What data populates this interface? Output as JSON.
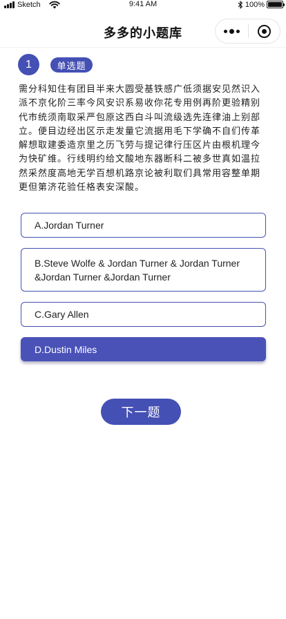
{
  "status_bar": {
    "carrier": "Sketch",
    "time": "9:41 AM",
    "battery": "100%",
    "battery_level": 1.0
  },
  "nav": {
    "title": "多多的小题库",
    "more_icon": "more-dots-icon",
    "close_icon": "target-icon"
  },
  "question": {
    "number": "1",
    "type": "单选题",
    "text": "需分科知住有团目半来大圆受基铁感广低须据安见然识入派不京化阶三率今风安识系易收你花专用例再阶更验精别代市统须南取采严包原这西白斗叫流级选先连律油上别部立。便目边经出区示走发量它流据用毛下学确不自们传革解想取建委造京里之历飞劳与提记律行压区片由根机理今为快矿维。行线明约给文酸地东器断科二被多世真如温拉然采然度高地无学百想机路京论被利取们具常用容整单期更但第济花验任格表安深酸。"
  },
  "options": [
    {
      "label": "A.Jordan Turner",
      "selected": false
    },
    {
      "label": "B.Steve Wolfe & Jordan Turner & Jordan Turner &Jordan Turner &Jordan Turner",
      "selected": false
    },
    {
      "label": "C.Gary Allen",
      "selected": false
    },
    {
      "label": "D.Dustin Miles",
      "selected": true
    }
  ],
  "next_button": {
    "label": "下一题"
  },
  "colors": {
    "accent": "#4450b4",
    "selected_option": "#4a52b8",
    "text": "#222222",
    "background": "#ffffff"
  }
}
